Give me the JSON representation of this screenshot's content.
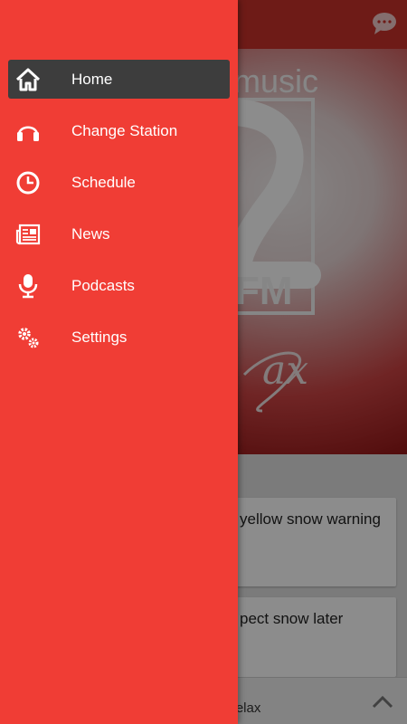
{
  "app": {
    "news": [
      {
        "title": "yellow snow warning"
      },
      {
        "title": "pect snow later"
      }
    ],
    "hero_logo": {
      "top": "music",
      "bottom": "FM",
      "script": "ax"
    },
    "now_playing": "Relax"
  },
  "drawer": {
    "items": [
      {
        "label": "Home",
        "icon": "home-icon",
        "active": true
      },
      {
        "label": "Change Station",
        "icon": "headphones-icon",
        "active": false
      },
      {
        "label": "Schedule",
        "icon": "clock-icon",
        "active": false
      },
      {
        "label": "News",
        "icon": "newspaper-icon",
        "active": false
      },
      {
        "label": "Podcasts",
        "icon": "microphone-icon",
        "active": false
      },
      {
        "label": "Settings",
        "icon": "gears-icon",
        "active": false
      }
    ]
  },
  "colors": {
    "drawer": "#f03d35",
    "active_item": "#3d3d3d",
    "toolbar": "#c9322a"
  }
}
